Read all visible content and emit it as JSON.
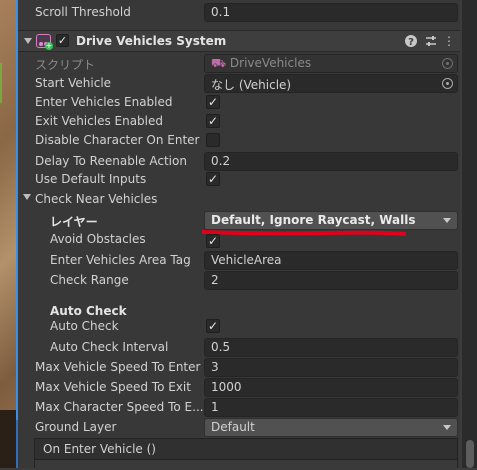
{
  "component": {
    "title": "Drive Vehicles System",
    "help_icon": "?",
    "settings_icon": "⇄",
    "more_icon": "⋮"
  },
  "rows": {
    "scroll_threshold": {
      "label": "Scroll Threshold",
      "value": "0.1"
    },
    "script": {
      "label": "スクリプト",
      "value": "DriveVehicles"
    },
    "start_vehicle": {
      "label": "Start Vehicle",
      "value": "なし (Vehicle)"
    },
    "enter_vehicles_enabled": {
      "label": "Enter Vehicles Enabled",
      "checked": true
    },
    "exit_vehicles_enabled": {
      "label": "Exit Vehicles Enabled",
      "checked": true
    },
    "disable_character_on_enter": {
      "label": "Disable Character On Enter",
      "checked": false
    },
    "delay_to_reenable_action": {
      "label": "Delay To Reenable Action",
      "value": "0.2"
    },
    "use_default_inputs": {
      "label": "Use Default Inputs",
      "checked": true
    },
    "check_near_vehicles": {
      "label": "Check Near Vehicles"
    },
    "layer": {
      "label": "レイヤー",
      "value": "Default, Ignore Raycast, Walls"
    },
    "avoid_obstacles": {
      "label": "Avoid Obstacles",
      "checked": true
    },
    "enter_vehicles_area_tag": {
      "label": "Enter Vehicles Area Tag",
      "value": "VehicleArea"
    },
    "check_range": {
      "label": "Check Range",
      "value": "2"
    },
    "auto_check_header": {
      "label": "Auto Check"
    },
    "auto_check": {
      "label": "Auto Check",
      "checked": true
    },
    "auto_check_interval": {
      "label": "Auto Check Interval",
      "value": "0.5"
    },
    "max_vehicle_speed_to_enter": {
      "label": "Max Vehicle Speed To Enter",
      "value": "3"
    },
    "max_vehicle_speed_to_exit": {
      "label": "Max Vehicle Speed To Exit",
      "value": "1000"
    },
    "max_character_speed_to_enter": {
      "label": "Max Character Speed To E...",
      "value": "1"
    },
    "ground_layer": {
      "label": "Ground Layer",
      "value": "Default"
    }
  },
  "event": {
    "title": "On Enter Vehicle ()"
  },
  "check_glyph": "✓",
  "colors": {
    "annotation": "#e0001b",
    "accent": "#3d8ee6"
  }
}
